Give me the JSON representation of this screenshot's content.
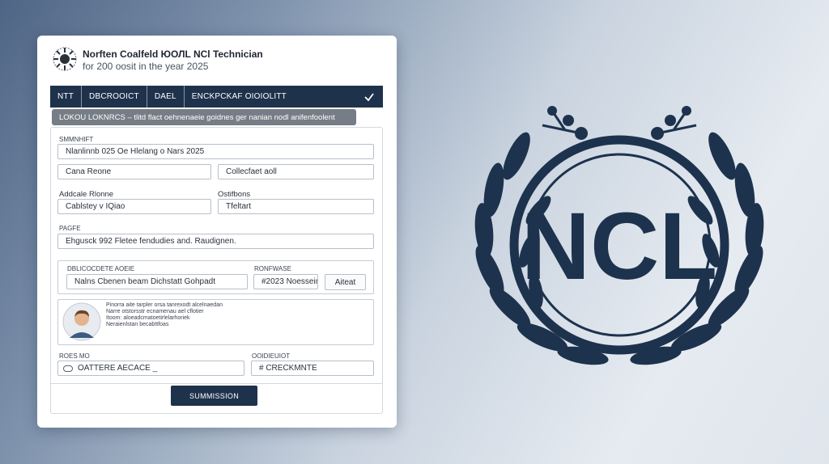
{
  "header": {
    "title": "Norften Coalfeld ЮОЛL NCl Technician",
    "subtitle": "for 200 oosit in the year 2025"
  },
  "nav": {
    "tabs": [
      "NTT",
      "DBCROOICT",
      "DAEL",
      "ENCKPCKAF OIOIOLITT"
    ]
  },
  "notice": {
    "text": "LOKOU LOKNRCS  –  tlitd flact oehnenaeie goidnes ger nanian nodl anifenfoolent"
  },
  "form": {
    "section_label": "SMMNHIFT",
    "row1_value": "Nlanlinnb 025 Oe Hlelang o Nars 2025",
    "row2_left": "Cana Reone",
    "row2_right": "Collecfaet aoll",
    "row3_label_left": "Addcale Rlonne",
    "row3_label_right": "Ostifbons",
    "row3_left": "Cablstey v IQiao",
    "row3_right": "Tfeltart",
    "row4_label": "PAGFE",
    "row4_value": "Ehgusck 992 Fletee fendudies and. Raudignen.",
    "sub_label_left": "DBLICOCDETE AOEIE",
    "sub_label_right": "RONFWASE",
    "sub_left": "Nalns Cbenen beam Dichstatt Gohpadt",
    "sub_mid": "#2023 Noesseinn",
    "sub_button": "Aiteat",
    "notes": [
      "Pinorra aite tarpler orsa tanrexodt alcelnaedan",
      "Narre otstorsstr ecnamenau ael cflotier",
      "Itoom: aloeadcmatoetirlelarhoriek",
      "Neraienlstan becabttfoas"
    ],
    "bottom_label_left": "ROES MO",
    "bottom_label_right": "OOIDIEUIOT",
    "bottom_left": "OATTERE AECACE _",
    "bottom_right": "# CRECKMNTE",
    "submit_label": "SUMMISSION"
  },
  "logo": {
    "text": "NCL",
    "color": "#1d324d"
  },
  "colors": {
    "navy": "#1f324c",
    "notice_bg": "#777d86",
    "card_bg": "#ffffff"
  }
}
